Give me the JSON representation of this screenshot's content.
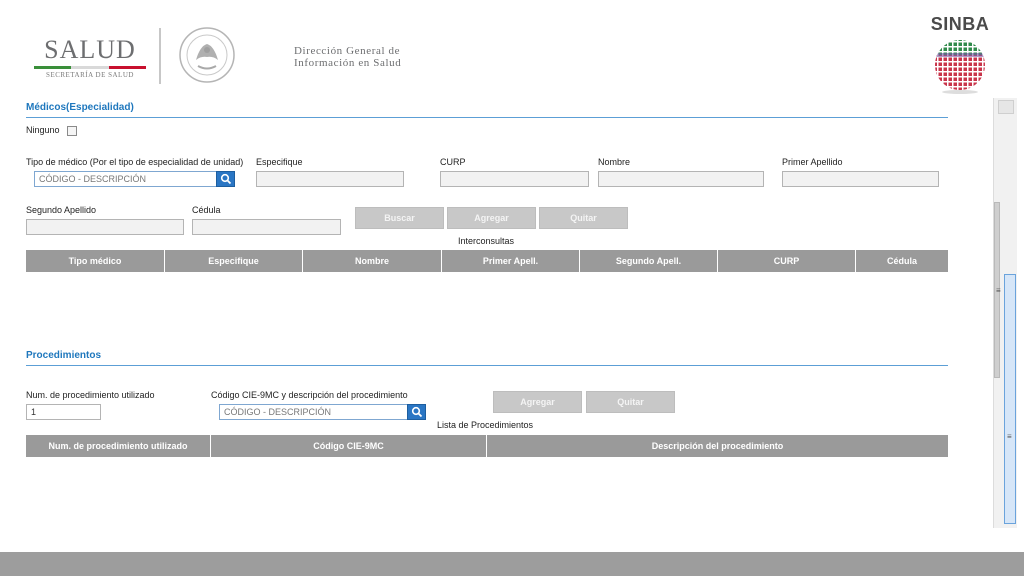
{
  "header": {
    "salud_word": "SALUD",
    "salud_sub": "SECRETARÍA DE SALUD",
    "dgis_line1": "Dirección General de",
    "dgis_line2": "Información en Salud",
    "sinba_word": "SINBA",
    "seal_label": "ESTADOS UNIDOS MEXICANOS"
  },
  "medicos": {
    "section_title": "Médicos(Especialidad)",
    "ninguno_label": "Ninguno",
    "tipo_label": "Tipo de médico (Por el tipo de especialidad de unidad)",
    "tipo_placeholder": "CÓDIGO - DESCRIPCIÓN",
    "especifique_label": "Especifique",
    "curp_label": "CURP",
    "nombre_label": "Nombre",
    "primer_apellido_label": "Primer Apellido",
    "segundo_apellido_label": "Segundo Apellido",
    "cedula_label": "Cédula",
    "buscar_label": "Buscar",
    "agregar_label": "Agregar",
    "quitar_label": "Quitar",
    "table_caption": "Interconsultas",
    "columns": [
      "Tipo médico",
      "Especifique",
      "Nombre",
      "Primer Apell.",
      "Segundo Apell.",
      "CURP",
      "Cédula"
    ]
  },
  "procedimientos": {
    "section_title": "Procedimientos",
    "num_label": "Num. de procedimiento utilizado",
    "num_value": "1",
    "codigo_label": "Código CIE-9MC y descripción del procedimiento",
    "codigo_placeholder": "CÓDIGO - DESCRIPCIÓN",
    "agregar_label": "Agregar",
    "quitar_label": "Quitar",
    "table_caption": "Lista de Procedimientos",
    "columns": [
      "Num. de procedimiento utilizado",
      "Código CIE-9MC",
      "Descripción del procedimiento"
    ]
  },
  "colors": {
    "accent": "#1e77bd",
    "header_gray": "#9a9a9a",
    "button_gray": "#c8c8c8",
    "footer_gray": "#9d9d9d"
  }
}
